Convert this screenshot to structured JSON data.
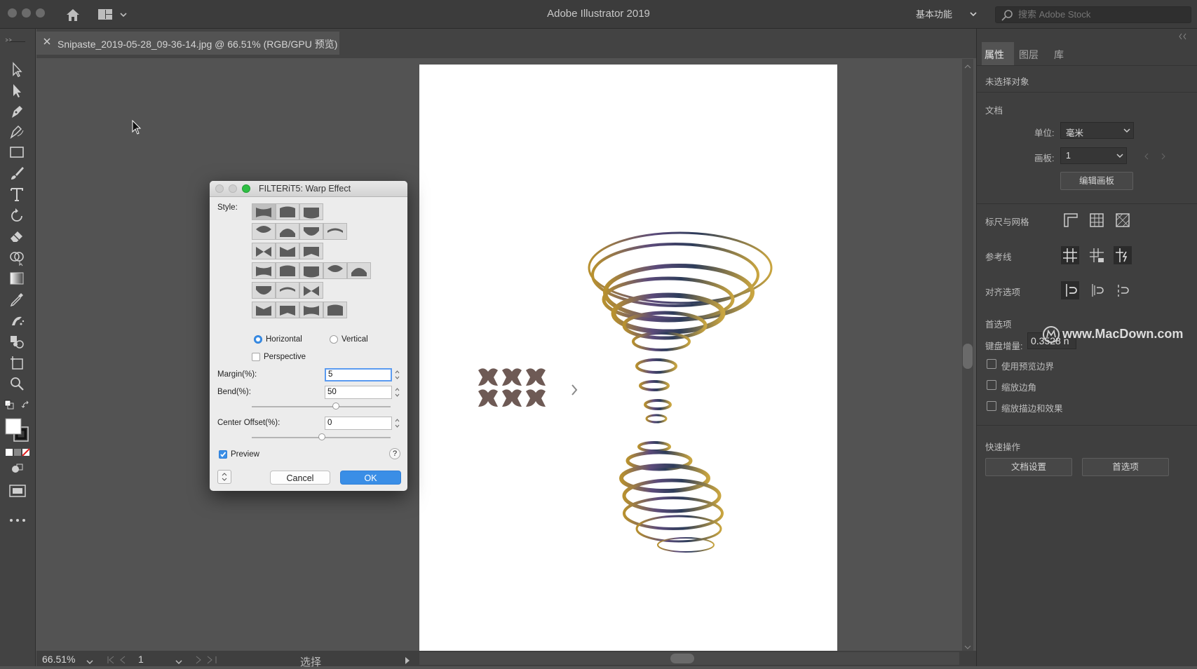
{
  "window": {
    "title": "Adobe Illustrator 2019"
  },
  "header": {
    "workspace": "基本功能",
    "stock_search_placeholder": "搜索 Adobe Stock"
  },
  "document": {
    "tab_label": "Snipaste_2019-05-28_09-36-14.jpg @ 66.51% (RGB/GPU 预览)"
  },
  "status": {
    "zoom": "66.51%",
    "artboard": "1",
    "tool": "选择"
  },
  "dialog": {
    "title": "FILTERiT5: Warp Effect",
    "style_label": "Style:",
    "style_rows": [
      3,
      4,
      3,
      5,
      3,
      4
    ],
    "orientation": {
      "horizontal": "Horizontal",
      "vertical": "Vertical",
      "selected": "horizontal"
    },
    "perspective_label": "Perspective",
    "perspective_checked": false,
    "margin_label": "Margin(%):",
    "margin_value": "5",
    "bend_label": "Bend(%):",
    "bend_value": "50",
    "bend_fraction": 0.6,
    "center_label": "Center Offset(%):",
    "center_value": "0",
    "center_fraction": 0.5,
    "preview_label": "Preview",
    "preview_checked": true,
    "help": "?",
    "cancel": "Cancel",
    "ok": "OK"
  },
  "panel": {
    "tabs": [
      "属性",
      "图层",
      "库"
    ],
    "active_tab": "属性",
    "no_selection": "未选择对象",
    "document_section": "文档",
    "unit_label": "单位:",
    "unit_value": "毫米",
    "artboard_label": "画板:",
    "artboard_value": "1",
    "edit_artboards": "编辑画板",
    "rulers_grids": "标尺与网格",
    "guides": "参考线",
    "snap_options": "对齐选项",
    "preferences": "首选项",
    "keyboard_increment_label": "键盘增量:",
    "keyboard_increment_value": "0.3528 n",
    "checkboxes": [
      "使用预览边界",
      "缩放边角",
      "缩放描边和效果"
    ],
    "quick_actions": "快速操作",
    "doc_setup": "文档设置",
    "prefs_button": "首选项"
  },
  "watermark": "www.MacDown.com",
  "colors": {
    "accent": "#3a8ee6",
    "dialog_bg": "#ececec",
    "ui_dark": "#3f3f3f"
  }
}
